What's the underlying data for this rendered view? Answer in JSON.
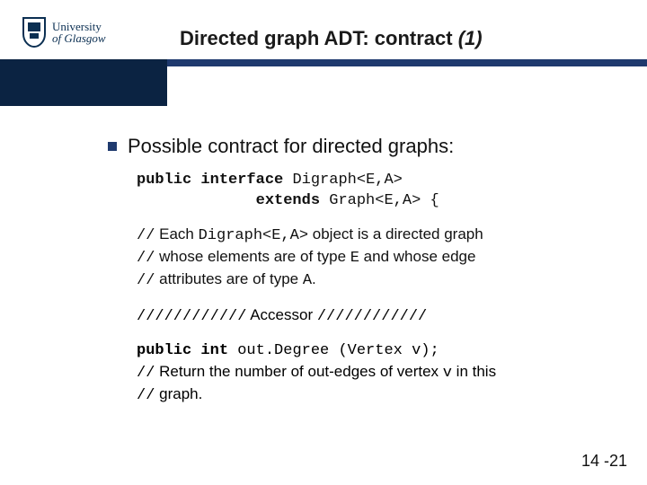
{
  "logo": {
    "line1": "University",
    "line2_prefix": "of",
    "line2_name": "Glasgow"
  },
  "title": {
    "main": "Directed graph ADT: contract ",
    "italic": "(1)"
  },
  "bullet": "Possible contract for directed graphs:",
  "code": {
    "line1_kw1": "public",
    "line1_kw2": "interface",
    "line1_rest": " Digraph<E,A>",
    "line2_indent": "             ",
    "line2_kw": "extends",
    "line2_rest": " Graph<E,A> {"
  },
  "comment1": {
    "l1_slash": "//",
    "l1_a": " Each ",
    "l1_mono": "Digraph<E,A>",
    "l1_b": " object is a directed graph",
    "l2_slash": "//",
    "l2_a": " whose elements are of type ",
    "l2_mono": "E",
    "l2_b": " and whose edge",
    "l3_slash": "//",
    "l3_a": " attributes are of type ",
    "l3_mono": "A",
    "l3_b": "."
  },
  "accessor": {
    "left": "////////////",
    "mid": " Accessor ",
    "right": "////////////"
  },
  "method": {
    "l1_kw1": "public",
    "l1_sp1": " ",
    "l1_kw2": "int",
    "l1_rest": " out.Degree (Vertex v);",
    "l2_slash": "//",
    "l2_a": " Return the number of out-edges of vertex ",
    "l2_mono": "v",
    "l2_b": " in this",
    "l3_slash": "//",
    "l3_a": " graph."
  },
  "slide_number": "14 -21"
}
